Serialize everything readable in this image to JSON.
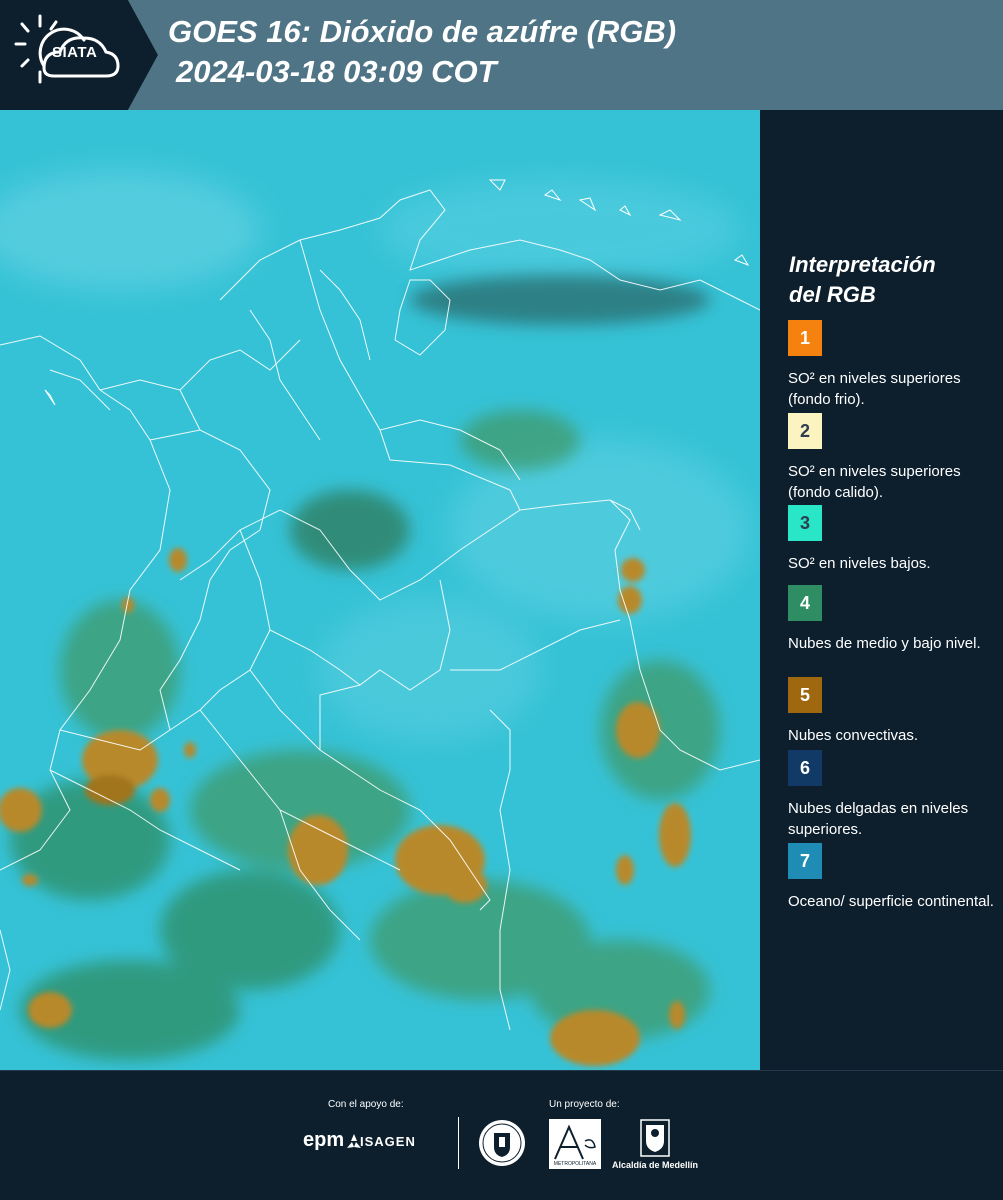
{
  "header": {
    "logo_text": "SIATA",
    "title_line1": "GOES 16: Dióxido de azúfre (RGB)",
    "title_line2": "2024-03-18 03:09 COT",
    "background_color": "#4f7485"
  },
  "map": {
    "ocean_color": "#36c2d6",
    "cloud_color": "#b8892a",
    "low_cloud_color": "#3f9a6a",
    "border_color": "#ffffff"
  },
  "legend": {
    "title_line1": "Interpretación",
    "title_line2": "del RGB",
    "items": [
      {
        "number": "1",
        "label": "SO² en niveles superiores (fondo frio).",
        "color": "#f5820f",
        "text_color": "#ffffff"
      },
      {
        "number": "2",
        "label": "SO² en niveles superiores (fondo calido).",
        "color": "#fbf3c0",
        "text_color": "#2c3e50"
      },
      {
        "number": "3",
        "label": "SO² en niveles bajos.",
        "color": "#29e6c6",
        "text_color": "#2c3e50"
      },
      {
        "number": "4",
        "label": "Nubes de medio y bajo nivel.",
        "color": "#2f8d63",
        "text_color": "#ffffff"
      },
      {
        "number": "5",
        "label": "Nubes convectivas.",
        "color": "#a0680e",
        "text_color": "#ffffff"
      },
      {
        "number": "6",
        "label": "Nubes delgadas en niveles superiores.",
        "color": "#123a66",
        "text_color": "#ffffff"
      },
      {
        "number": "7",
        "label": "Oceano/ superficie continental.",
        "color": "#1e8cb4",
        "text_color": "#ffffff"
      }
    ]
  },
  "footer": {
    "support_label": "Con el apoyo de:",
    "project_label": "Un proyecto de:",
    "epm_text": "epm",
    "isagen_text": "ISAGEN",
    "area_text": "Área",
    "area_subtext": "METROPOLITANA",
    "alcaldia_text": "Alcaldía de Medellín"
  }
}
